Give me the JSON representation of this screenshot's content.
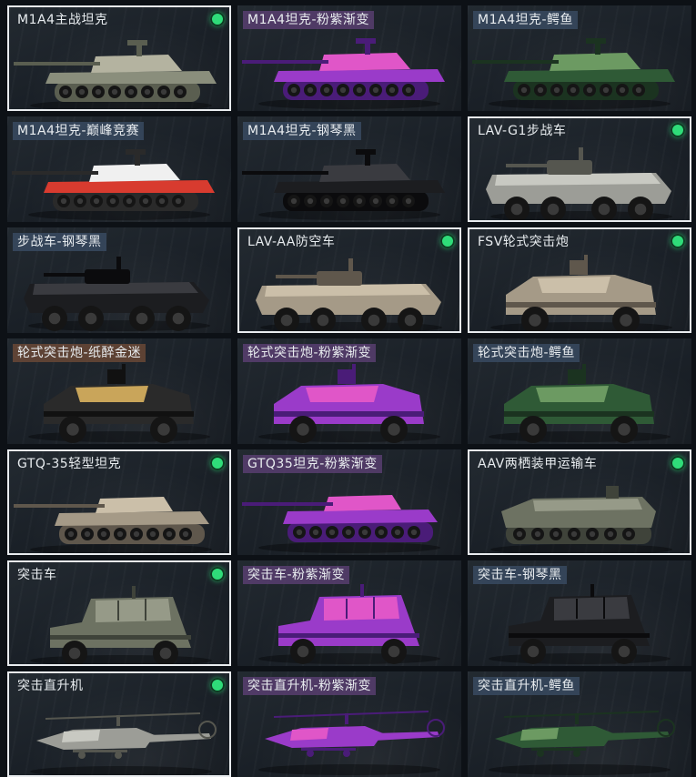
{
  "items": [
    {
      "label": "M1A4主战坦克",
      "type": "tank",
      "skin": "camo",
      "tag": "std",
      "selected": true,
      "owned": true
    },
    {
      "label": "M1A4坦克-粉紫渐变",
      "type": "tank",
      "skin": "purple",
      "tag": "purple",
      "selected": false,
      "owned": false
    },
    {
      "label": "M1A4坦克-鳄鱼",
      "type": "tank",
      "skin": "croc",
      "tag": "blue",
      "selected": false,
      "owned": false
    },
    {
      "label": "M1A4坦克-巅峰竞赛",
      "type": "tank",
      "skin": "race",
      "tag": "blue",
      "selected": false,
      "owned": false
    },
    {
      "label": "M1A4坦克-钢琴黑",
      "type": "tank",
      "skin": "black",
      "tag": "blue",
      "selected": false,
      "owned": false
    },
    {
      "label": "LAV-G1步战车",
      "type": "ifv",
      "skin": "grey",
      "tag": "std",
      "selected": true,
      "owned": true
    },
    {
      "label": "步战车-钢琴黑",
      "type": "ifv",
      "skin": "black",
      "tag": "blue",
      "selected": false,
      "owned": false
    },
    {
      "label": "LAV-AA防空车",
      "type": "ifv",
      "skin": "tan",
      "tag": "std",
      "selected": true,
      "owned": true
    },
    {
      "label": "FSV轮式突击炮",
      "type": "armored-car",
      "skin": "tan",
      "tag": "std",
      "selected": true,
      "owned": true
    },
    {
      "label": "轮式突击炮-纸醉金迷",
      "type": "armored-car",
      "skin": "gold",
      "tag": "brown",
      "selected": false,
      "owned": false
    },
    {
      "label": "轮式突击炮-粉紫渐变",
      "type": "armored-car",
      "skin": "purple",
      "tag": "purple",
      "selected": false,
      "owned": false
    },
    {
      "label": "轮式突击炮-鳄鱼",
      "type": "armored-car",
      "skin": "croc",
      "tag": "blue",
      "selected": false,
      "owned": false
    },
    {
      "label": "GTQ-35轻型坦克",
      "type": "light-tank",
      "skin": "tan",
      "tag": "std",
      "selected": true,
      "owned": true
    },
    {
      "label": "GTQ35坦克-粉紫渐变",
      "type": "light-tank",
      "skin": "purple",
      "tag": "purple",
      "selected": false,
      "owned": false
    },
    {
      "label": "AAV两栖装甲运输车",
      "type": "amphibious",
      "skin": "olive",
      "tag": "std",
      "selected": true,
      "owned": true
    },
    {
      "label": "突击车",
      "type": "assault-vehicle",
      "skin": "olive",
      "tag": "std",
      "selected": true,
      "owned": true
    },
    {
      "label": "突击车-粉紫渐变",
      "type": "assault-vehicle",
      "skin": "purple",
      "tag": "purple",
      "selected": false,
      "owned": false
    },
    {
      "label": "突击车-钢琴黑",
      "type": "assault-vehicle",
      "skin": "black",
      "tag": "blue",
      "selected": false,
      "owned": false
    },
    {
      "label": "突击直升机",
      "type": "helicopter",
      "skin": "grey",
      "tag": "std",
      "selected": true,
      "owned": true
    },
    {
      "label": "突击直升机-粉紫渐变",
      "type": "helicopter",
      "skin": "purple",
      "tag": "purple",
      "selected": false,
      "owned": false
    },
    {
      "label": "突击直升机-鳄鱼",
      "type": "helicopter",
      "skin": "croc",
      "tag": "blue",
      "selected": false,
      "owned": false
    }
  ],
  "skins": {
    "camo": {
      "base": "#8a8e7c",
      "dark": "#5a5e50",
      "accent": "#b4b3a0"
    },
    "purple": {
      "base": "#9a3bc9",
      "dark": "#4a1c78",
      "accent": "#e056c8"
    },
    "croc": {
      "base": "#2f5a36",
      "dark": "#1b3320",
      "accent": "#6c9a62"
    },
    "race": {
      "base": "#d83b2f",
      "dark": "#2a2a2a",
      "accent": "#f0f0f0"
    },
    "black": {
      "base": "#1c1d20",
      "dark": "#0b0b0d",
      "accent": "#3a3b40"
    },
    "grey": {
      "base": "#9c9d97",
      "dark": "#55564f",
      "accent": "#c8c9c2"
    },
    "tan": {
      "base": "#a59a87",
      "dark": "#5f574c",
      "accent": "#cbbfa9"
    },
    "gold": {
      "base": "#2a2a2a",
      "dark": "#111111",
      "accent": "#c9a55a"
    },
    "olive": {
      "base": "#6d7262",
      "dark": "#3f433a",
      "accent": "#969a88"
    }
  }
}
